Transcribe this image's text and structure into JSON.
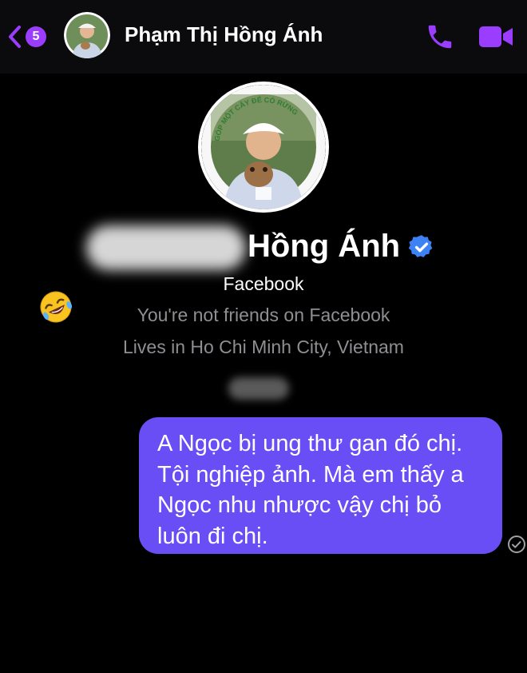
{
  "header": {
    "back_badge": "5",
    "contact_name": "Phạm Thị Hồng Ánh",
    "icons": {
      "back": "chevron-left-icon",
      "call": "phone-icon",
      "video": "video-camera-icon"
    },
    "accent_color": "#9b3dff"
  },
  "profile": {
    "display_name_visible": "Hồng Ánh",
    "verified_icon": "verified-badge-icon",
    "platform": "Facebook",
    "friend_status": "You're not friends on Facebook",
    "location": "Lives in Ho Chi Minh City, Vietnam",
    "avatar_ring_text": "GÓP MỘT CÂY ĐỂ CÓ RỪNG"
  },
  "reaction_emoji": "🤣",
  "messages": [
    {
      "direction": "outgoing",
      "lines": [
        "A Ngọc bị ung thư gan đó chị.",
        "Tội nghiệp ảnh. Mà em thấy a",
        "Ngọc nhu nhược vậy chị bỏ",
        "luôn đi chị."
      ],
      "bubble_color": "#6a4ef5",
      "status_icon": "sent-check-icon"
    }
  ]
}
